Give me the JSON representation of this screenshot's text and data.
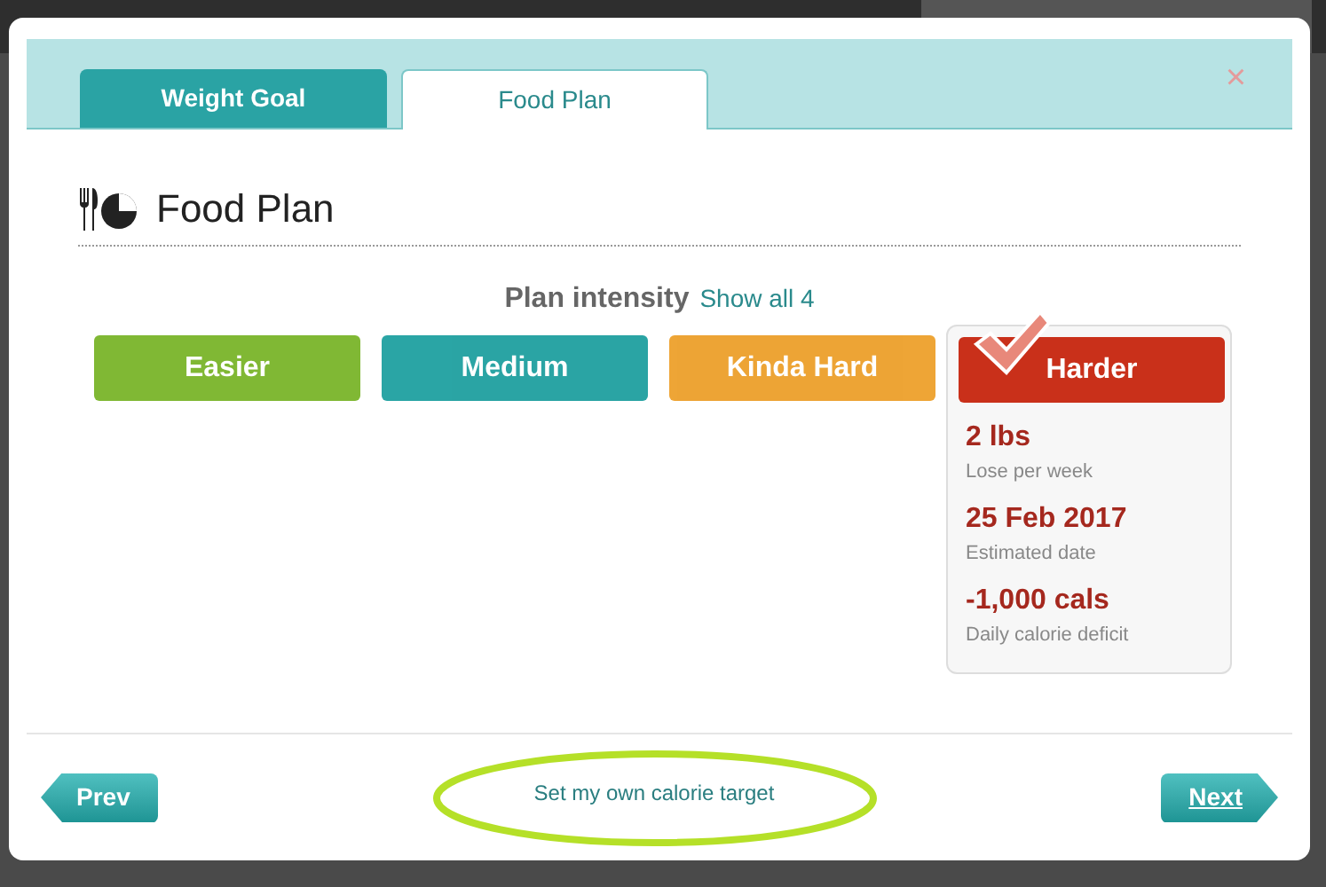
{
  "dialog": {
    "tabs": [
      {
        "label": "Weight Goal",
        "selected": false
      },
      {
        "label": "Food Plan",
        "selected": true
      }
    ],
    "close": "×",
    "heading": "Food Plan",
    "intensity_label": "Plan intensity",
    "show_all": "Show all 4",
    "options": [
      {
        "label": "Easier",
        "color": "#7ab52a",
        "selected": false
      },
      {
        "label": "Medium",
        "color": "#1fa0a0",
        "selected": false
      },
      {
        "label": "Kinda Hard",
        "color": "#eda02b",
        "selected": false
      },
      {
        "label": "Harder",
        "color": "#c9301a",
        "selected": true
      }
    ],
    "details": [
      {
        "value": "2 lbs",
        "caption": "Lose per week"
      },
      {
        "value": "25 Feb 2017",
        "caption": "Estimated date"
      },
      {
        "value": "-1,000 cals",
        "caption": "Daily calorie deficit"
      }
    ],
    "prev": "Prev",
    "custom_target": "Set my own calorie target",
    "next": "Next"
  }
}
